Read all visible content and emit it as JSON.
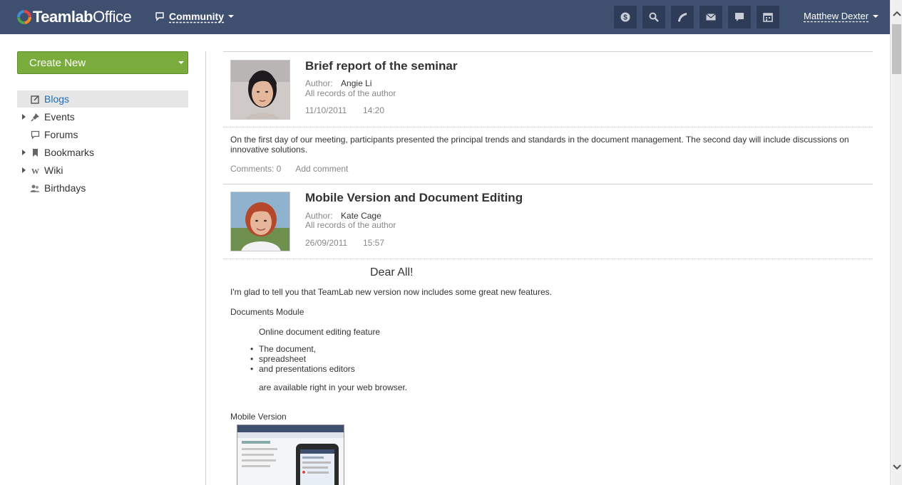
{
  "header": {
    "logo_text_bold": "Teamlab",
    "logo_text": "Office",
    "module": "Community",
    "icons": [
      "dollar-icon",
      "search-icon",
      "feed-icon",
      "mail-icon",
      "chat-icon",
      "calendar-icon"
    ],
    "user": "Matthew Dexter"
  },
  "sidebar": {
    "create_label": "Create New",
    "items": [
      {
        "label": "Blogs",
        "icon": "blog-icon",
        "expandable": false,
        "active": true
      },
      {
        "label": "Events",
        "icon": "pin-icon",
        "expandable": true,
        "active": false
      },
      {
        "label": "Forums",
        "icon": "forum-icon",
        "expandable": false,
        "active": false
      },
      {
        "label": "Bookmarks",
        "icon": "bookmark-icon",
        "expandable": true,
        "active": false
      },
      {
        "label": "Wiki",
        "icon": "wiki-icon",
        "expandable": true,
        "active": false
      },
      {
        "label": "Birthdays",
        "icon": "people-icon",
        "expandable": false,
        "active": false
      }
    ]
  },
  "posts": [
    {
      "title": "Brief report of the seminar",
      "author_label": "Author:",
      "author": "Angie Li",
      "all_records": "All records of the author",
      "date": "11/10/2011",
      "time": "14:20",
      "body": "On the first day of our meeting, participants presented the principal trends and standards in the document management. The second day will include discussions on innovative solutions.",
      "comments": "Comments: 0",
      "add_comment": "Add comment"
    },
    {
      "title": "Mobile Version and Document Editing",
      "author_label": "Author:",
      "author": "Kate Cage",
      "all_records": "All records of the author",
      "date": "26/09/2011",
      "time": "15:57",
      "greeting": "Dear All!",
      "intro": "I'm glad to tell you that TeamLab new version now includes some great new features.",
      "section1": "Documents Module",
      "feature": "Online document editing feature",
      "bullets": [
        "The document,",
        "spreadsheet",
        "and presentations editors"
      ],
      "available": "are available right in your web browser.",
      "section2": "Mobile Version"
    }
  ],
  "colors": {
    "header_bg": "#3e4f6f",
    "create_btn": "#7aab3d",
    "active_link": "#1f6cb0"
  }
}
